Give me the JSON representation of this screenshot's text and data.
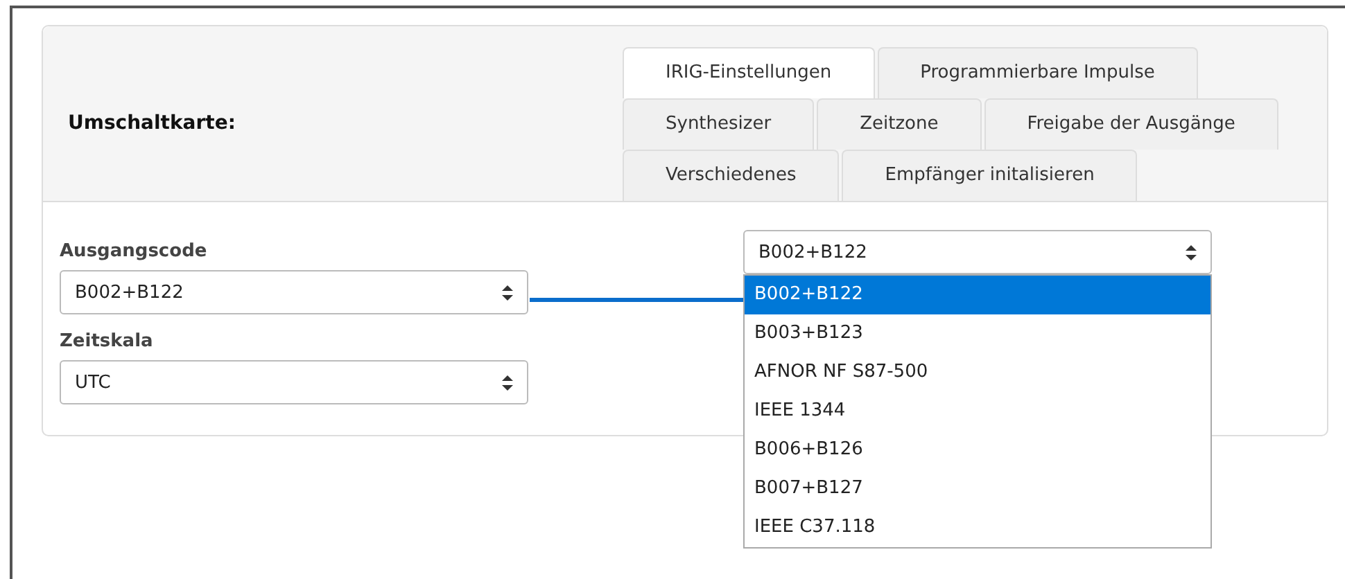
{
  "title": "Umschaltkarte:",
  "tab_rows": [
    [
      {
        "label": "IRIG-Einstellungen",
        "selected": true
      },
      {
        "label": "Programmierbare Impulse",
        "selected": false
      }
    ],
    [
      {
        "label": "Synthesizer",
        "selected": false
      },
      {
        "label": "Zeitzone",
        "selected": false
      },
      {
        "label": "Freigabe der Ausgänge",
        "selected": false
      }
    ],
    [
      {
        "label": "Verschiedenes",
        "selected": false
      },
      {
        "label": "Empfänger initalisieren",
        "selected": false
      }
    ]
  ],
  "fields": [
    {
      "label": "Ausgangscode",
      "value": "B002+B122"
    },
    {
      "label": "Zeitskala",
      "value": "UTC"
    }
  ],
  "dropdown_callout": {
    "value": "B002+B122",
    "options": [
      {
        "label": "B002+B122",
        "selected": true
      },
      {
        "label": "B003+B123",
        "selected": false
      },
      {
        "label": "AFNOR NF S87-500",
        "selected": false
      },
      {
        "label": "IEEE 1344",
        "selected": false
      },
      {
        "label": "B006+B126",
        "selected": false
      },
      {
        "label": "B007+B127",
        "selected": false
      },
      {
        "label": "IEEE C37.118",
        "selected": false
      }
    ]
  }
}
